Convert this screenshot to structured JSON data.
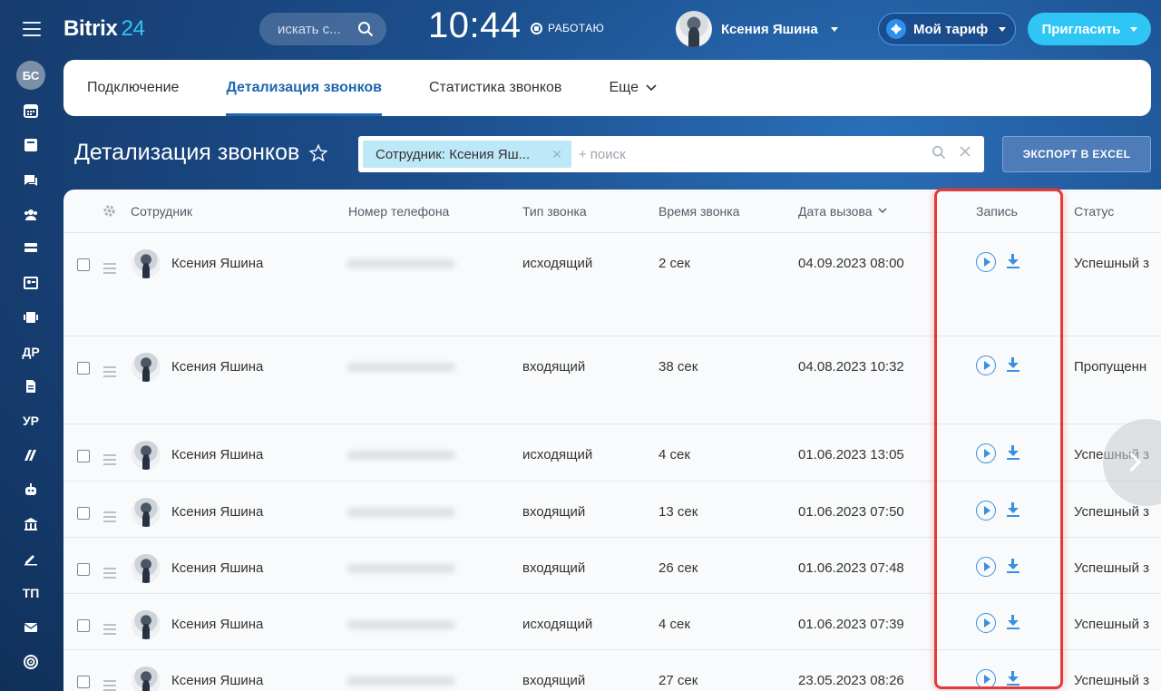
{
  "header": {
    "logo_name": "Bitrix",
    "logo_num": "24",
    "search_placeholder": "искать с...",
    "clock": "10:44",
    "work_status": "РАБОТАЮ",
    "user_name": "Ксения Яшина",
    "tariff_label": "Мой тариф",
    "invite_label": "Пригласить"
  },
  "sidebar": {
    "avatar_initials": "БС",
    "text_items": [
      "ДР",
      "УР",
      "ТП"
    ]
  },
  "tabs": [
    {
      "label": "Подключение",
      "active": false
    },
    {
      "label": "Детализация звонков",
      "active": true
    },
    {
      "label": "Статистика звонков",
      "active": false
    },
    {
      "label": "Еще",
      "active": false
    }
  ],
  "page": {
    "title": "Детализация звонков",
    "filter_chip": "Сотрудник: Ксения Яш...",
    "filter_placeholder": "+ поиск",
    "export_label": "ЭКСПОРТ В EXCEL"
  },
  "table": {
    "columns": [
      "Сотрудник",
      "Номер телефона",
      "Тип звонка",
      "Время звонка",
      "Дата вызова",
      "Запись",
      "Статус"
    ],
    "rows": [
      {
        "employee": "Ксения Яшина",
        "type": "исходящий",
        "duration": "2 сек",
        "date": "04.09.2023 08:00",
        "status": "Успешный з"
      },
      {
        "employee": "Ксения Яшина",
        "type": "входящий",
        "duration": "38 сек",
        "date": "04.08.2023 10:32",
        "status": "Пропущенн"
      },
      {
        "employee": "Ксения Яшина",
        "type": "исходящий",
        "duration": "4 сек",
        "date": "01.06.2023 13:05",
        "status": "Успешный з"
      },
      {
        "employee": "Ксения Яшина",
        "type": "входящий",
        "duration": "13 сек",
        "date": "01.06.2023 07:50",
        "status": "Успешный з"
      },
      {
        "employee": "Ксения Яшина",
        "type": "входящий",
        "duration": "26 сек",
        "date": "01.06.2023 07:48",
        "status": "Успешный з"
      },
      {
        "employee": "Ксения Яшина",
        "type": "исходящий",
        "duration": "4 сек",
        "date": "01.06.2023 07:39",
        "status": "Успешный з"
      },
      {
        "employee": "Ксения Яшина",
        "type": "входящий",
        "duration": "27 сек",
        "date": "23.05.2023 08:26",
        "status": "Успешный з"
      }
    ]
  },
  "colors": {
    "accent": "#2fc6f6",
    "active_tab": "#2067b0",
    "highlight": "#e33b3b",
    "icon_blue": "#3b8fe0"
  }
}
